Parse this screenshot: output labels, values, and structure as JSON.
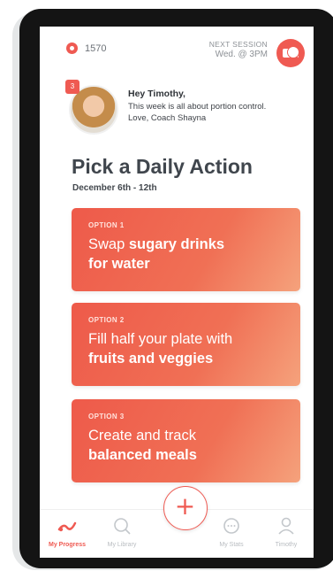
{
  "status": {
    "points": "1570",
    "next_session_label": "NEXT SESSION",
    "next_session_time": "Wed. @ 3PM"
  },
  "coach": {
    "badge_count": "3",
    "greeting": "Hey Timothy,",
    "message": "This week is all about portion control.",
    "signature": "Love, Coach Shayna"
  },
  "page": {
    "title": "Pick a Daily Action",
    "dates": "December 6th - 12th"
  },
  "options": [
    {
      "label": "OPTION 1",
      "text_plain": "Swap ",
      "text_bold": "sugary drinks",
      "text_plain2": " ",
      "text_bold2": "for water"
    },
    {
      "label": "OPTION 2",
      "text_plain": "Fill half your plate with",
      "text_bold": "fruits and veggies"
    },
    {
      "label": "OPTION 3",
      "text_plain": "Create and track",
      "text_bold": "balanced meals"
    }
  ],
  "tabs": [
    {
      "label": "My Progress",
      "icon": "progress-icon",
      "active": true
    },
    {
      "label": "My Library",
      "icon": "search-icon",
      "active": false
    },
    {
      "label": "My Stats",
      "icon": "chat-icon",
      "active": false
    },
    {
      "label": "Timothy",
      "icon": "profile-icon",
      "active": false
    }
  ],
  "add_button": "+",
  "colors": {
    "accent": "#ef5a52",
    "text_dark": "#40464d",
    "tab_inactive": "#b8bcc0"
  }
}
